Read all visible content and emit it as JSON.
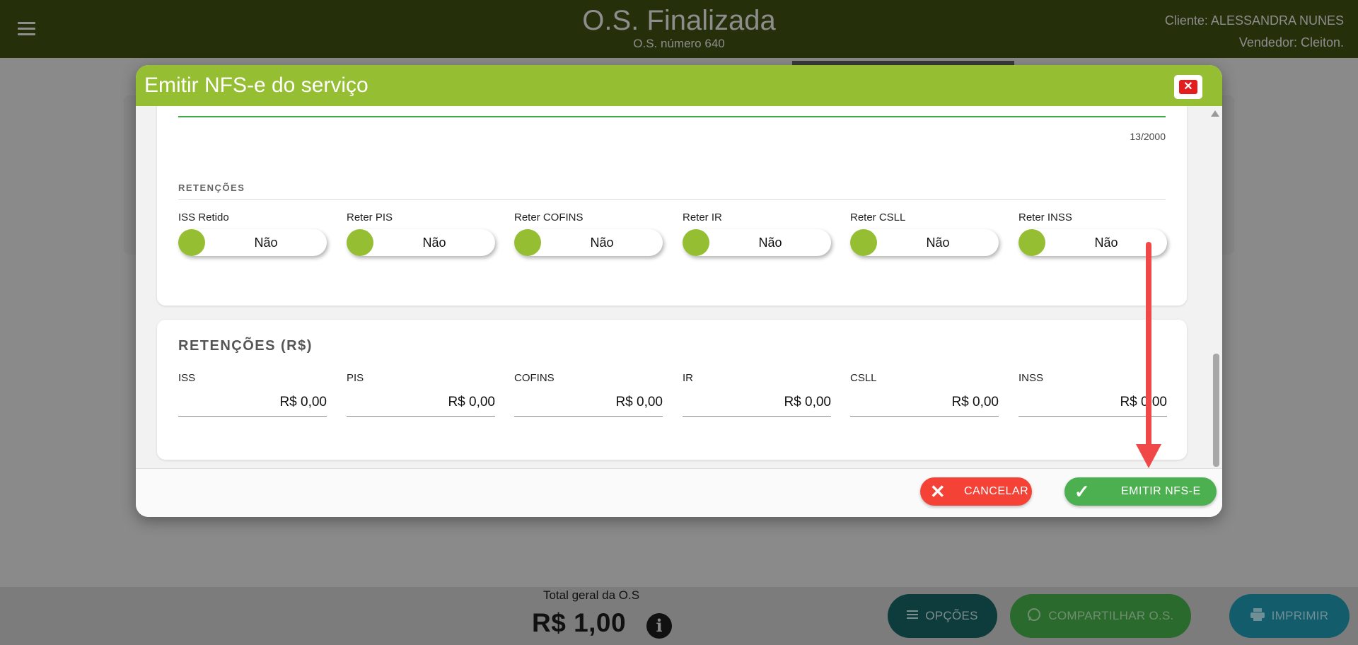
{
  "header": {
    "title": "O.S. Finalizada",
    "subtitle": "O.S. número 640",
    "client": "Cliente: ALESSANDRA NUNES",
    "seller": "Vendedor: Cleiton."
  },
  "modal": {
    "title": "Emitir NFS-e do serviço",
    "close_label": "✕",
    "counter": "13/2000",
    "retencoes_heading": "RETENÇÕES",
    "toggles": [
      {
        "label": "ISS Retido",
        "value": "Não"
      },
      {
        "label": "Reter PIS",
        "value": "Não"
      },
      {
        "label": "Reter COFINS",
        "value": "Não"
      },
      {
        "label": "Reter IR",
        "value": "Não"
      },
      {
        "label": "Reter CSLL",
        "value": "Não"
      },
      {
        "label": "Reter INSS",
        "value": "Não"
      }
    ],
    "values_heading": "RETENÇÕES (R$)",
    "values": [
      {
        "label": "ISS",
        "value": "R$ 0,00"
      },
      {
        "label": "PIS",
        "value": "R$ 0,00"
      },
      {
        "label": "COFINS",
        "value": "R$ 0,00"
      },
      {
        "label": "IR",
        "value": "R$ 0,00"
      },
      {
        "label": "CSLL",
        "value": "R$ 0,00"
      },
      {
        "label": "INSS",
        "value": "R$ 0,00"
      }
    ],
    "cancel_label": "CANCELAR",
    "emit_label": "EMITIR NFS-E"
  },
  "footer": {
    "total_label": "Total geral da O.S",
    "total_value": "R$ 1,00",
    "options_label": "OPÇÕES",
    "share_label": "COMPARTILHAR O.S.",
    "print_label": "IMPRIMIR"
  },
  "colors": {
    "header_bg": "#25300a",
    "modal_header": "#95be33",
    "toggle_knob": "#95be33",
    "cancel": "#f44336",
    "emit": "#4caf50",
    "annotation_arrow": "#f04848"
  }
}
